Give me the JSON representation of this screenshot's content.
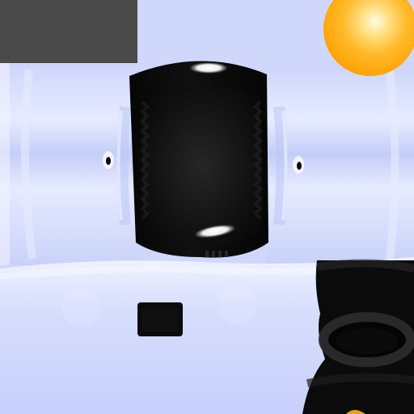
{
  "texture": {
    "palette": {
      "ice_light": "#e9eeff",
      "ice_mid": "#c9d2fa",
      "ice_dark": "#aebcf0",
      "ice_shadow": "#9fb0ea",
      "black": "#0b0b0b",
      "black_soft": "#1b1b1b",
      "gray_block": "#4a4a4a",
      "sun_core": "#fff7d6",
      "sun_mid": "#ffbf2e",
      "sun_edge": "#ff9f00",
      "highlight": "#ffffff"
    },
    "icons": {
      "sun": "orange-glow-icon",
      "left_eye": "small-eye-icon",
      "right_eye": "small-eye-icon"
    }
  }
}
